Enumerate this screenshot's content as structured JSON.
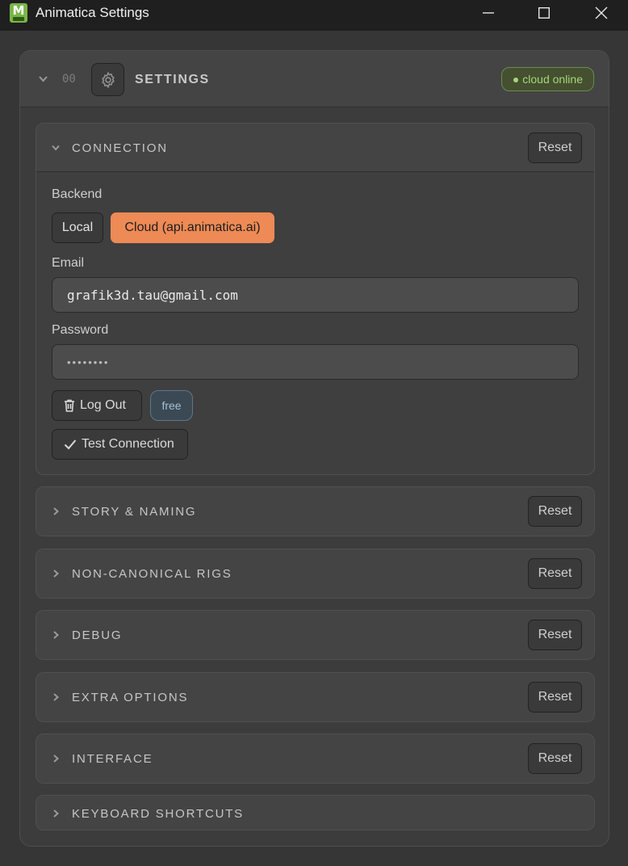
{
  "window": {
    "app_icon_letter": "M",
    "title": "Animatica Settings",
    "minimize_icon": "minimize-icon",
    "maximize_icon": "maximize-icon",
    "close_icon": "close-icon"
  },
  "panel": {
    "number": "00",
    "title": "SETTINGS",
    "status": "● cloud online",
    "status_color": "#a9d37c",
    "icon": "gear-icon"
  },
  "connection": {
    "title": "CONNECTION",
    "reset_label": "Reset",
    "backend_label": "Backend",
    "backend_options": [
      "Local",
      "Cloud (api.animatica.ai)"
    ],
    "backend_selected": "Cloud (api.animatica.ai)",
    "accent_color": "#ee8a55",
    "email_label": "Email",
    "email_value": "grafik3d.tau@gmail.com",
    "password_label": "Password",
    "password_value": "••••••••",
    "logout_label": "Log Out",
    "tier_badge": "free",
    "test_label": "Test Connection"
  },
  "sections": [
    {
      "title": "STORY & NAMING",
      "reset_label": "Reset"
    },
    {
      "title": "NON-CANONICAL RIGS",
      "reset_label": "Reset"
    },
    {
      "title": "DEBUG",
      "reset_label": "Reset"
    },
    {
      "title": "EXTRA OPTIONS",
      "reset_label": "Reset"
    },
    {
      "title": "INTERFACE",
      "reset_label": "Reset"
    },
    {
      "title": "KEYBOARD SHORTCUTS"
    }
  ]
}
